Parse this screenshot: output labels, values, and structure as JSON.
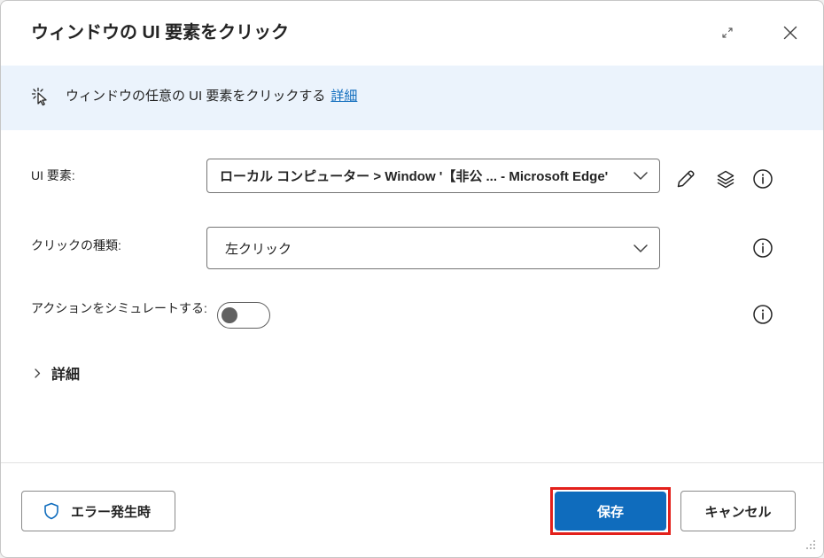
{
  "dialog": {
    "title": "ウィンドウの UI 要素をクリック",
    "expand_icon": "expand-icon",
    "close_icon": "close-icon"
  },
  "banner": {
    "icon": "cursor-click-icon",
    "text": "ウィンドウの任意の UI 要素をクリックする",
    "link": "詳細"
  },
  "form": {
    "ui_element": {
      "label": "UI 要素:",
      "value": "ローカル コンピューター > Window '【非公 ... - Microsoft Edge'",
      "action_icons": [
        "pencil-icon",
        "layers-icon",
        "info-icon"
      ]
    },
    "click_type": {
      "label": "クリックの種類:",
      "value": "左クリック",
      "info_icon": "info-icon"
    },
    "simulate": {
      "label": "アクションをシミュレートする:",
      "enabled": false,
      "info_icon": "info-icon"
    },
    "advanced": {
      "label": "詳細",
      "expanded": false,
      "icon": "chevron-right-icon"
    }
  },
  "footer": {
    "on_error": {
      "label": "エラー発生時",
      "icon": "shield-icon"
    },
    "save": {
      "label": "保存"
    },
    "cancel": {
      "label": "キャンセル"
    }
  },
  "theme": {
    "accent": "#0f6cbd",
    "banner_bg": "#ebf3fc",
    "highlight": "#e3201b",
    "text": "#242424",
    "link": "#0f6cbd"
  }
}
